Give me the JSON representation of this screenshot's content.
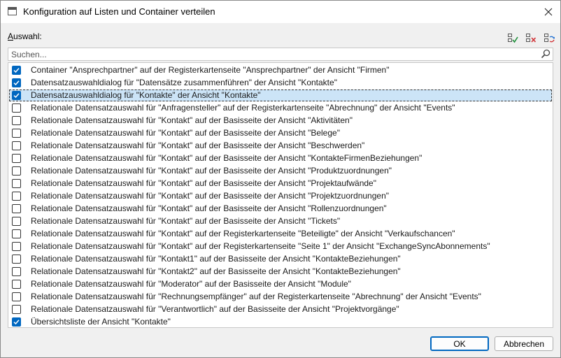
{
  "window": {
    "title": "Konfiguration auf Listen und Container verteilen"
  },
  "section": {
    "label_accel": "A",
    "label_rest": "uswahl:"
  },
  "toolbar": {
    "icons": [
      "check-all-icon",
      "uncheck-all-icon",
      "invert-selection-icon"
    ]
  },
  "search": {
    "placeholder": "Suchen..."
  },
  "items": [
    {
      "label": "Container \"Ansprechpartner\" auf der Registerkartenseite \"Ansprechpartner\" der Ansicht \"Firmen\"",
      "checked": true
    },
    {
      "label": "Datensatzauswahldialog für \"Datensätze zusammenführen\" der Ansicht \"Kontakte\"",
      "checked": true
    },
    {
      "label": "Datensatzauswahldialog für \"Kontakte\" der Ansicht \"Kontakte\"",
      "checked": true,
      "selected": true
    },
    {
      "label": "Relationale Datensatzauswahl für \"Anfragensteller\" auf der Registerkartenseite \"Abrechnung\" der Ansicht \"Events\"",
      "checked": false
    },
    {
      "label": "Relationale Datensatzauswahl für \"Kontakt\" auf der Basisseite der Ansicht \"Aktivitäten\"",
      "checked": false
    },
    {
      "label": "Relationale Datensatzauswahl für \"Kontakt\" auf der Basisseite der Ansicht \"Belege\"",
      "checked": false
    },
    {
      "label": "Relationale Datensatzauswahl für \"Kontakt\" auf der Basisseite der Ansicht \"Beschwerden\"",
      "checked": false
    },
    {
      "label": "Relationale Datensatzauswahl für \"Kontakt\" auf der Basisseite der Ansicht \"KontakteFirmenBeziehungen\"",
      "checked": false
    },
    {
      "label": "Relationale Datensatzauswahl für \"Kontakt\" auf der Basisseite der Ansicht \"Produktzuordnungen\"",
      "checked": false
    },
    {
      "label": "Relationale Datensatzauswahl für \"Kontakt\" auf der Basisseite der Ansicht \"Projektaufwände\"",
      "checked": false
    },
    {
      "label": "Relationale Datensatzauswahl für \"Kontakt\" auf der Basisseite der Ansicht \"Projektzuordnungen\"",
      "checked": false
    },
    {
      "label": "Relationale Datensatzauswahl für \"Kontakt\" auf der Basisseite der Ansicht \"Rollenzuordnungen\"",
      "checked": false
    },
    {
      "label": "Relationale Datensatzauswahl für \"Kontakt\" auf der Basisseite der Ansicht \"Tickets\"",
      "checked": false
    },
    {
      "label": "Relationale Datensatzauswahl für \"Kontakt\" auf der Registerkartenseite \"Beteiligte\" der Ansicht \"Verkaufschancen\"",
      "checked": false
    },
    {
      "label": "Relationale Datensatzauswahl für \"Kontakt\" auf der Registerkartenseite \"Seite 1\" der Ansicht \"ExchangeSyncAbonnements\"",
      "checked": false
    },
    {
      "label": "Relationale Datensatzauswahl für \"Kontakt1\" auf der Basisseite der Ansicht \"KontakteBeziehungen\"",
      "checked": false
    },
    {
      "label": "Relationale Datensatzauswahl für \"Kontakt2\" auf der Basisseite der Ansicht \"KontakteBeziehungen\"",
      "checked": false
    },
    {
      "label": "Relationale Datensatzauswahl für \"Moderator\" auf der Basisseite der Ansicht \"Module\"",
      "checked": false
    },
    {
      "label": "Relationale Datensatzauswahl für \"Rechnungsempfänger\" auf der Registerkartenseite \"Abrechnung\" der Ansicht \"Events\"",
      "checked": false
    },
    {
      "label": "Relationale Datensatzauswahl für \"Verantwortlich\" auf der Basisseite der Ansicht \"Projektvorgänge\"",
      "checked": false
    },
    {
      "label": "Übersichtsliste der Ansicht \"Kontakte\"",
      "checked": true
    }
  ],
  "buttons": {
    "ok": "OK",
    "cancel": "Abbrechen"
  },
  "colors": {
    "accent": "#0067c0",
    "selection": "#cce4f7"
  }
}
